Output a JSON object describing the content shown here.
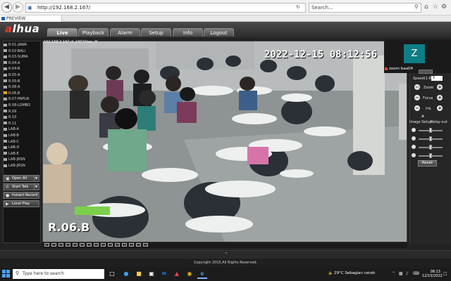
{
  "browser": {
    "address": "http://192.168.2.167/",
    "search_placeholder": "Search...",
    "tab_title": "PREVIEW"
  },
  "app": {
    "logo_a": "a",
    "logo_rest": "lhua",
    "nav": [
      "Live",
      "Playback",
      "Alarm",
      "Setup",
      "Info",
      "Logout"
    ],
    "active_nav": "Live"
  },
  "sidebar": {
    "channels": [
      "R.01-JAWA",
      "R.02-BALI",
      "R.03-SUMA",
      "R.04-A",
      "R.04-B",
      "R.05-A",
      "R.05-B",
      "R.06-A",
      "R.06.B",
      "R.07-PAPUA",
      "R.08-LOMBO",
      "R.09",
      "R.10",
      "R.11",
      "LAB-A",
      "LAB-B",
      "LAB-C",
      "LAB-D",
      "LAB-E",
      "LAB-JRSN",
      "LAB-JRSN"
    ],
    "selected_index": 8,
    "buttons": {
      "open_all": "Open All",
      "start_talk": "Start Talk",
      "instant_record": "Instant Record",
      "local_play": "Local Play"
    }
  },
  "video": {
    "info": "192.168.2.167_9_1867Kbps_M",
    "timestamp": "2022-12-15  08:12:56",
    "room_label": "R.06.B"
  },
  "zoom": {
    "avatar_letter": "Z",
    "name": "zoom baa04"
  },
  "ptz": {
    "speed_label": "Speed(1-8):",
    "speed_value": "5",
    "zoom_label": "Zoom",
    "focus_label": "Focus",
    "iris_label": "Iris",
    "image_setup": "Image Setup",
    "relay_out": "Relay-out",
    "reset": "Reset"
  },
  "footer": {
    "copyright": "Copyright 2015,All Rights Reserved."
  },
  "taskbar": {
    "search_placeholder": "Type here to search",
    "weather": "29°C  Sebagian cerah",
    "time": "08:13",
    "date": "12/15/2022"
  },
  "colors": {
    "brand_red": "#e23b2e",
    "zoom_teal": "#0e7d85",
    "selected_channel": "#e2a81a"
  }
}
